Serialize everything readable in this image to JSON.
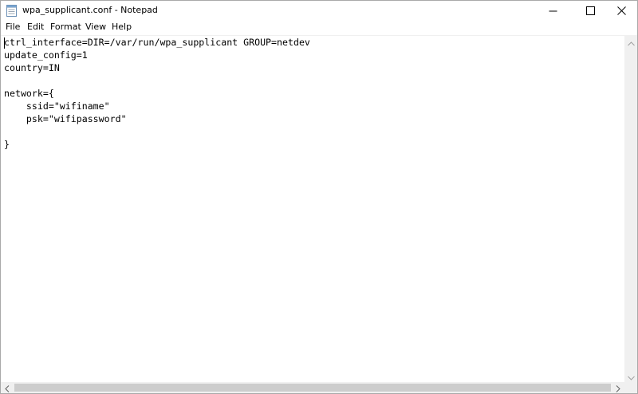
{
  "window": {
    "title": "wpa_supplicant.conf - Notepad",
    "icon": "notepad-icon"
  },
  "caption_buttons": {
    "minimize": "minimize-icon",
    "maximize": "maximize-icon",
    "close": "close-icon"
  },
  "menu": {
    "items": [
      "File",
      "Edit",
      "Format",
      "View",
      "Help"
    ]
  },
  "editor": {
    "lines": [
      "ctrl_interface=DIR=/var/run/wpa_supplicant GROUP=netdev",
      "update_config=1",
      "country=IN",
      "",
      "network={",
      "    ssid=\"wifiname\"",
      "    psk=\"wifipassword\"",
      "",
      "}"
    ]
  },
  "scrollbars": {
    "up_arrow": "scroll-up-icon",
    "down_arrow": "scroll-down-icon",
    "left_arrow": "scroll-left-icon",
    "right_arrow": "scroll-right-icon"
  }
}
